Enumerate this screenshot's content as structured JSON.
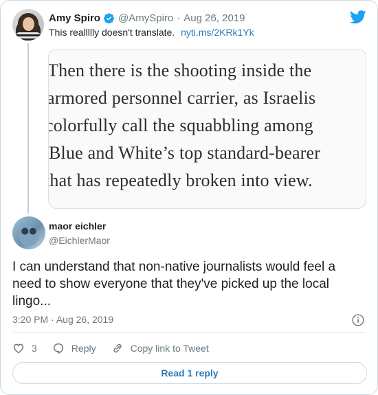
{
  "parent": {
    "author_name": "Amy Spiro",
    "handle": "@AmySpiro",
    "separator": "·",
    "date": "Aug 26, 2019",
    "text": "This reallllly doesn't translate.",
    "link": "nyti.ms/2KRk1Yk",
    "media_lines": [
      "Then there is the shooting inside the",
      "armored personnel carrier, as Israelis",
      "colorfully call the squabbling among",
      "Blue and White’s top standard-bearer",
      "that has repeatedly broken into view."
    ]
  },
  "reply": {
    "author_name": "maor eichler",
    "handle": "@EichlerMaor",
    "text": "I can understand that non-native journalists would feel a need to show everyone that they've picked up the local lingo...",
    "time": "3:20 PM",
    "separator": "·",
    "date": "Aug 26, 2019"
  },
  "actions": {
    "like_count": "3",
    "reply_label": "Reply",
    "copy_link_label": "Copy link to Tweet"
  },
  "read_replies_label": "Read 1 reply",
  "colors": {
    "link": "#2b7bb9",
    "verified": "#1da1f2",
    "secondary_text": "#697882"
  },
  "icons": {
    "verified": "verified-badge-icon",
    "brand": "twitter-bird-icon",
    "info": "info-icon",
    "like": "heart-icon",
    "reply": "reply-bubble-icon",
    "copy_link": "link-icon"
  }
}
